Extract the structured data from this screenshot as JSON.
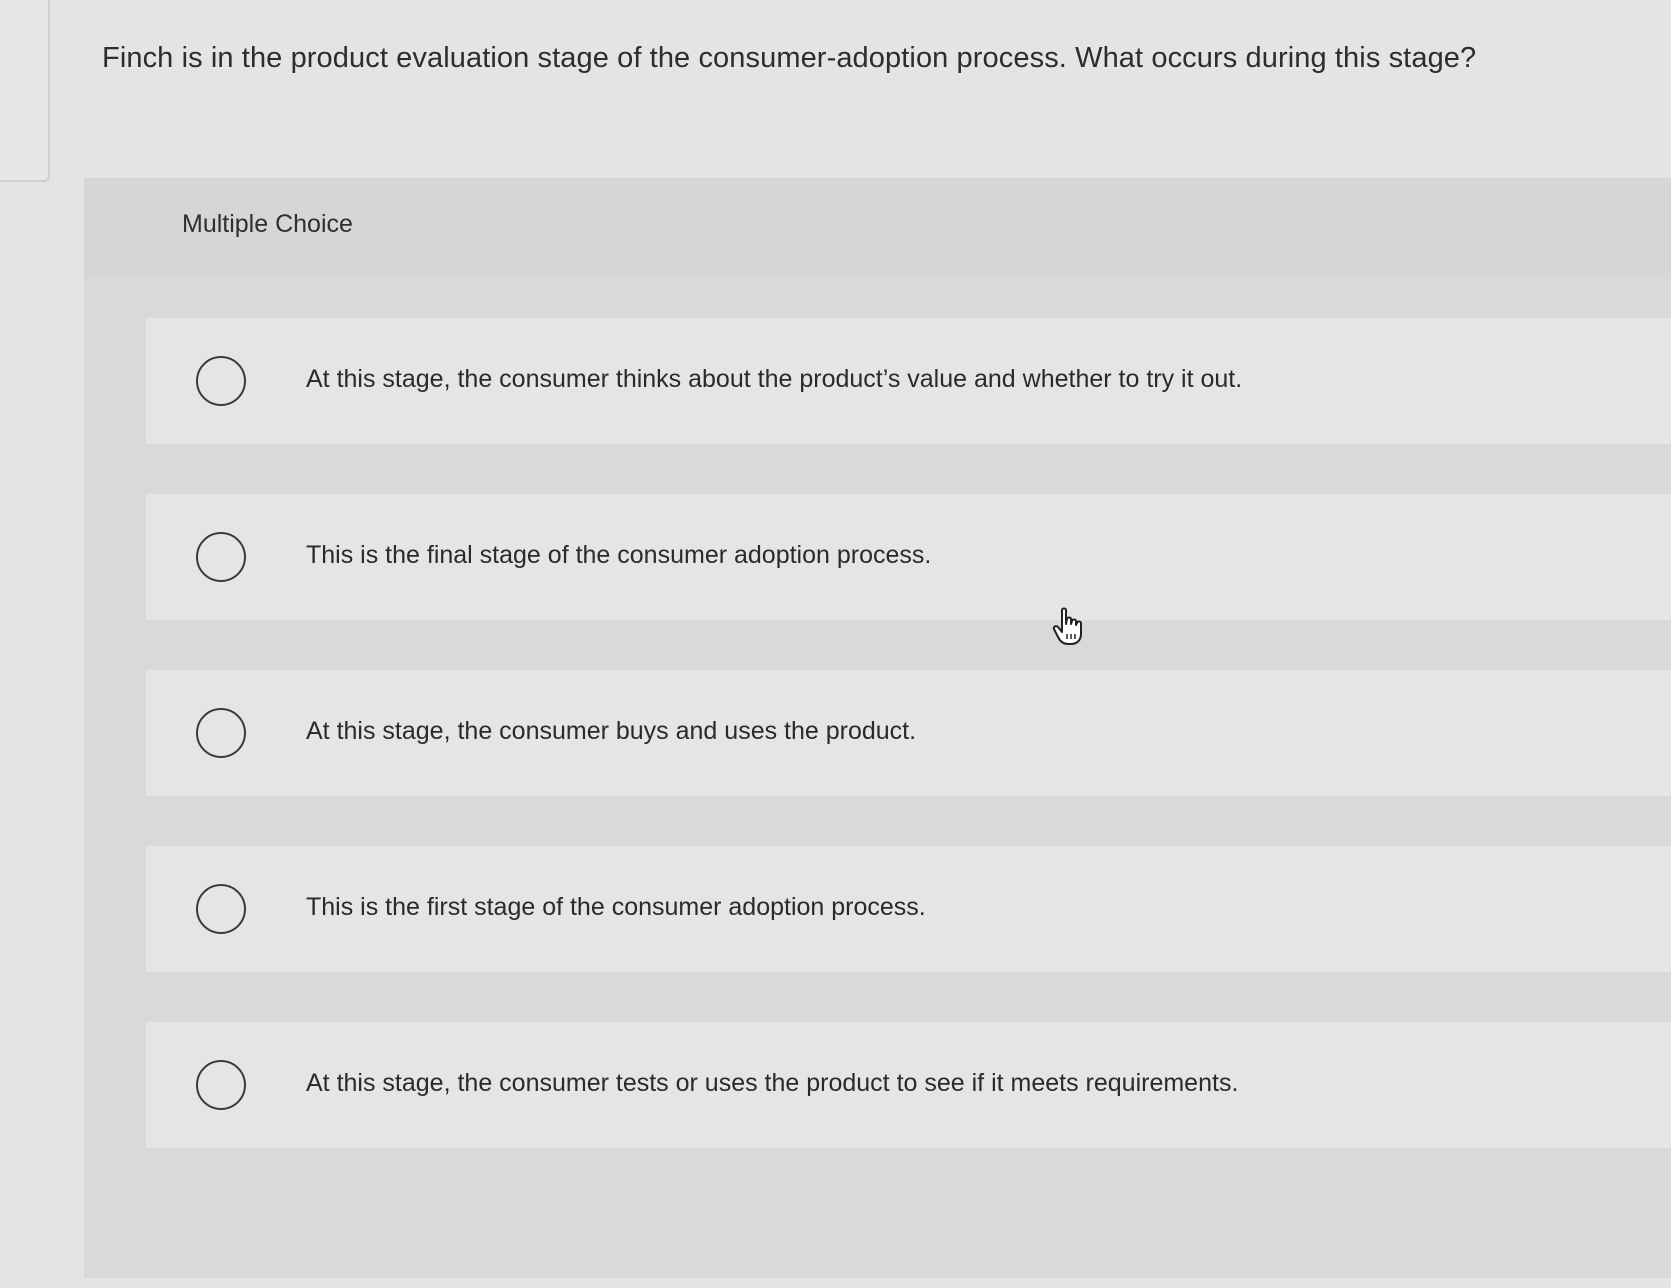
{
  "question": {
    "text": "Finch is in the product evaluation stage of the consumer-adoption process. What occurs during this stage?"
  },
  "multiple_choice": {
    "title": "Multiple Choice",
    "options": [
      {
        "label": "At this stage, the consumer thinks about the product’s value and whether to try it out.",
        "selected": false
      },
      {
        "label": "This is the final stage of the consumer adoption process.",
        "selected": false
      },
      {
        "label": "At this stage, the consumer buys and uses the product.",
        "selected": false
      },
      {
        "label": "This is the first stage of the consumer adoption process.",
        "selected": false
      },
      {
        "label": "At this stage, the consumer tests or uses the product to see if it meets requirements.",
        "selected": false
      }
    ]
  },
  "icons": {
    "radio": "radio-button-icon",
    "cursor": "hand-pointer-icon"
  },
  "colors": {
    "background": "#e4e4e3",
    "panel": "#d9d9d8",
    "option_row": "#e5e5e4",
    "text": "#2b2b2b"
  }
}
